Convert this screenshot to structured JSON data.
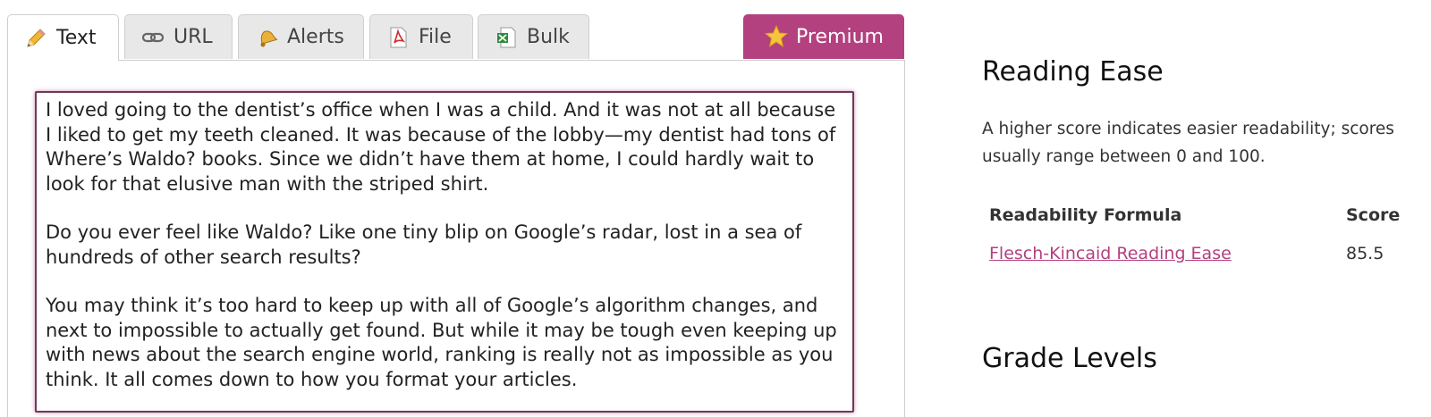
{
  "tabs": [
    {
      "label": "Text",
      "icon": "pencil-icon",
      "active": true
    },
    {
      "label": "URL",
      "icon": "link-icon",
      "active": false
    },
    {
      "label": "Alerts",
      "icon": "bell-icon",
      "active": false
    },
    {
      "label": "File",
      "icon": "pdf-file-icon",
      "active": false
    },
    {
      "label": "Bulk",
      "icon": "excel-file-icon",
      "active": false
    }
  ],
  "premium": {
    "label": "Premium",
    "icon": "star-icon",
    "color": "#b3407f"
  },
  "editor": {
    "paragraphs": [
      "I loved going to the dentist’s office when I was a child. And it was not at all because I liked to get my teeth cleaned. It was because of the lobby—my dentist had tons of Where’s Waldo? books. Since we didn’t have them at home, I could hardly wait to look for that elusive man with the striped shirt.",
      "Do you ever feel like Waldo? Like one tiny blip on Google’s radar, lost in a sea of hundreds of other search results?",
      "You may think it’s too hard to keep up with all of Google’s algorithm changes, and next to impossible to actually get found. But while it may be tough even keeping up with news about the search engine world, ranking is really not as impossible as you think. It all comes down to how you format your articles."
    ]
  },
  "sidebar": {
    "reading_ease": {
      "title": "Reading Ease",
      "description": "A higher score indicates easier readability; scores usually range between 0 and 100.",
      "table": {
        "headers": [
          "Readability Formula",
          "Score"
        ],
        "rows": [
          {
            "formula": "Flesch-Kincaid Reading Ease",
            "score": "85.5"
          }
        ]
      }
    },
    "grade_levels": {
      "title": "Grade Levels"
    }
  },
  "colors": {
    "accent": "#b3407f",
    "tab_bg": "#e8e8e8"
  }
}
